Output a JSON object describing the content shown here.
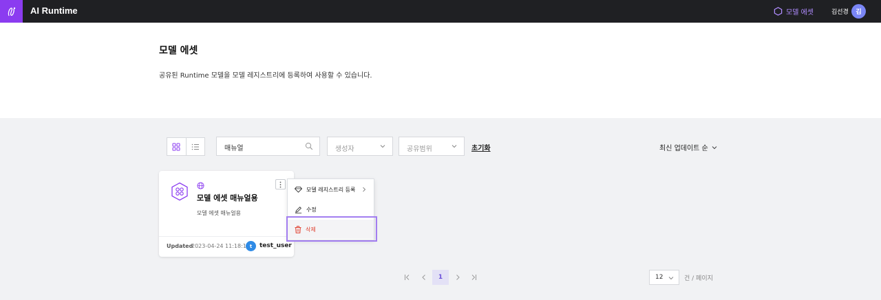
{
  "topbar": {
    "app_title": "AI Runtime",
    "nav_item": "모델 에셋",
    "user_name": "김선경",
    "avatar_initial": "김"
  },
  "header": {
    "title": "모델 에셋",
    "description": "공유된 Runtime 모델을 모델 레지스트리에 등록하여 사용할 수 있습니다."
  },
  "toolbar": {
    "search_value": "매뉴얼",
    "creator_placeholder": "생성자",
    "scope_placeholder": "공유범위",
    "reset_label": "초기화",
    "sort_label": "최신 업데이트 순"
  },
  "cards": [
    {
      "title": "모델 에셋 매뉴얼용",
      "description": "모델 에셋 매뉴얼용",
      "updated_label": "Updated",
      "updated_date": "2023-04-24 11:18:11",
      "user_initial": "t",
      "user_name": "test_user"
    }
  ],
  "context_menu": {
    "items": [
      {
        "label": "모델 레지스트리 등록",
        "icon": "diamond-icon"
      },
      {
        "label": "수정",
        "icon": "pencil-icon"
      },
      {
        "label": "삭제",
        "icon": "trash-icon"
      }
    ]
  },
  "pagination": {
    "current_page": "1",
    "per_page": "12",
    "per_page_label": "건 / 페이지"
  },
  "colors": {
    "accent": "#8b3cf0",
    "delete": "#e0402f",
    "user_badge": "#2f8be6"
  }
}
